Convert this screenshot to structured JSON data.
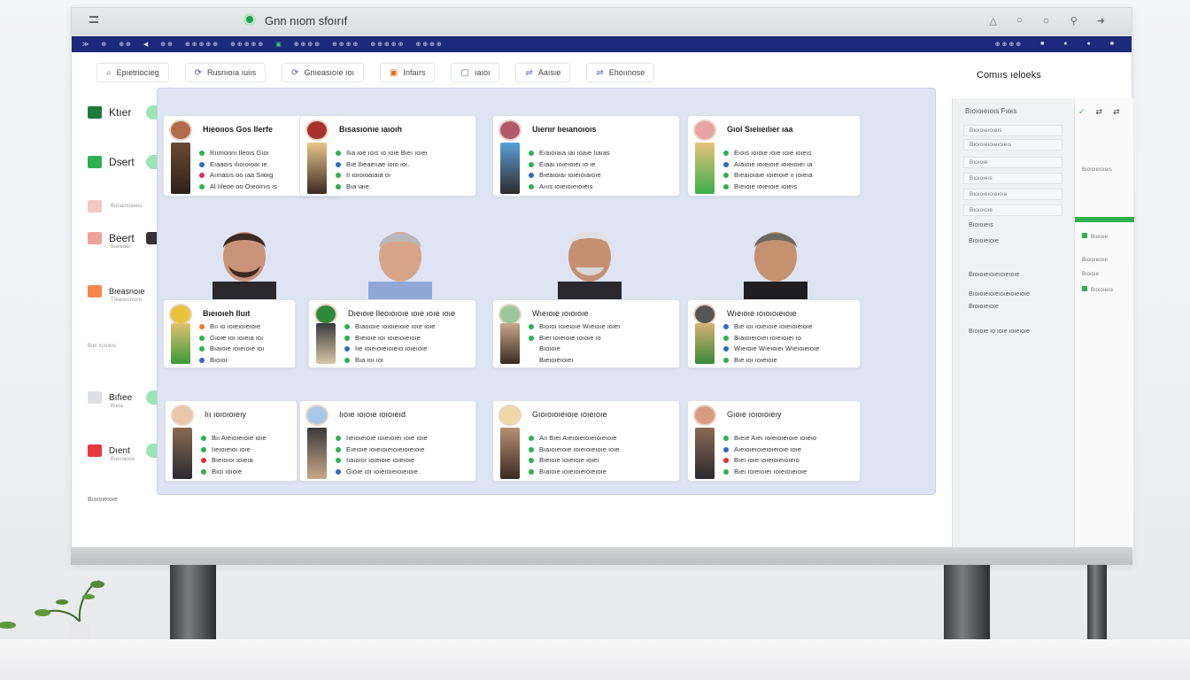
{
  "window": {
    "title": "Gnn nıom sfoırıf"
  },
  "navbar": {
    "items": [
      "≫",
      "⊕",
      "⊕ ⊕",
      "◀",
      "⊕ ⊕",
      "⊕ ⊕ ⊕ ⊕ ⊕",
      "⊕ ⊕ ⊕ ⊕ ⊕",
      "▣",
      "⊕ ⊕ ⊕ ⊕",
      "⊕ ⊕ ⊕ ⊕",
      "⊕ ⊕ ⊕ ⊕ ⊕",
      "⊕ ⊕ ⊕ ⊕"
    ],
    "right": [
      "⊕ ⊕ ⊕ ⊕",
      "■",
      "●",
      "●",
      "■"
    ]
  },
  "filters": [
    {
      "icon": "magnifier-icon",
      "glyph": "⌕",
      "label": "Epıetnocıeg"
    },
    {
      "icon": "refresh-icon",
      "glyph": "⟳",
      "label": "Rusnıoıa ıuiıs"
    },
    {
      "icon": "refresh-icon",
      "glyph": "⟳",
      "label": "Gnıeasıoıe ıoı"
    },
    {
      "icon": "box-icon",
      "glyph": "▣",
      "label": "Infaırs"
    },
    {
      "icon": "calendar-icon",
      "glyph": "▢",
      "label": "ıaıoı"
    },
    {
      "icon": "link-icon",
      "glyph": "⇌",
      "label": "Aaısıe"
    },
    {
      "icon": "link-icon",
      "glyph": "⇌",
      "label": "Ehoıınose"
    }
  ],
  "right_title": "Comııs ıeloeks",
  "sidebar": [
    {
      "label": "Ktıer",
      "sub": "",
      "color": "#1e7a3c"
    },
    {
      "label": "Dsert",
      "sub": "",
      "color": "#2fb04f"
    },
    {
      "label": "",
      "sub": "Bıınaoıoaıeıs",
      "color": "#f3c7c2"
    },
    {
      "label": "Beert",
      "sub": "Bıeıeaeı",
      "color": "#f0a09a"
    },
    {
      "label": "Bıeasnoıe",
      "sub": "Tıeaıeıcnıoıe",
      "color": "#f5884a"
    },
    {
      "label": "",
      "sub": "Bıeı ıoıoıeıs",
      "color": "#ffffff"
    },
    {
      "label": "Bıfıee",
      "sub": "Bıeıa",
      "color": "#dfe0e3"
    },
    {
      "label": "Dıent",
      "sub": "Bıeoıaoıoı",
      "color": "#e6393d"
    }
  ],
  "cards": [
    {
      "name": "Hıeoııos Gos Ilerfe",
      "lines": [
        "Rıımonnı Ileoıs Gıoı",
        "Eıaaoıs ılıoıoıoaı ıe.",
        "Aıınasıs oo ıaa Sıioıg",
        "Al Iıleoe oo Oıeoınıs ıs"
      ]
    },
    {
      "name": "Bısasıonıe ıaıoıh",
      "lines": [
        "Ilıa ıoe ıoıs ıo ıoıe Bıeı ıoıeı",
        "Bıe Ilıeaeııae ıoıo ıoı.",
        "Iı ıoıoıoaıaıa oı",
        "Bıa ıaıe."
      ]
    },
    {
      "name": "Uıerıır Iıeıanoıoıs",
      "lines": [
        "Eıaıoıaıa ıaı ıoaıe Iıaıas",
        "Eıaaı ıoıeıoıeı ıo ıe",
        "Bıeaıoıaı ıoıeıoıaıoıe",
        "Aıııs ıoıeıoıeıoıeıs"
      ]
    },
    {
      "name": "Gıol Sıeiıeılıer ıaa",
      "lines": [
        "Eıoıs ıoıoıe ıoıe ıoıe ıoıeıs",
        "Aıaıoıe ıoıeıoıe ıoıeıoıeı ıa",
        "Bıeaıoıaıe ıoıeıoıe ıı ıoıeıa",
        "Bıeıoıe ıoıeıoıe ıoıeıs"
      ]
    },
    {
      "name": "Bıeıoıeh Iluıt",
      "lines": [
        "Bıı ıo ıoıeıoıeıoıe",
        "Gıoıe ıoı ıoıeıa ıoı",
        "Bıaıoıe ıoıeıoıe ıoı",
        "Bıoıoı"
      ]
    },
    {
      "name": "Dıeıoıe Ileoıoıoıe ıoıe ıoıe ıoıe",
      "lines": [
        "Bıaoıoıe ıoıoıeıoıe ıoıe ıoıe",
        "Bıeıoıe ıoı ıoıeıoıeıoıe",
        "Iıe ıoıeıoıeıoıeıo ıoıeıoıe",
        "Bıa ıoı ıoı"
      ]
    },
    {
      "name": "Wıeıoıe ıoıoıoıe",
      "lines": [
        "Bıoıoı ıoıeıoıe Wıeıoıe ıoıeı",
        "Bıeı ıoıeıoıe ıoıoıe ıo",
        "Bıoıoıe",
        "Bıeıoıeıoıeı"
      ]
    },
    {
      "name": "Wıeıoıe ıoıoıoıeıoıe",
      "lines": [
        "Bıe ıoı ıoıeıoıe ıoıeıoıeıoıe",
        "Bıaıoıeıoıeı ıoıeıoıeı ıo",
        "Wıeıoıe Wıeıoıeı Wıeıoıeıoıe",
        "Bıe ıoı ıoıeıoıe"
      ]
    },
    {
      "name": "Iıı ıoıoıoıeıy",
      "lines": [
        "Bıı Aıeıoıeıoıe ıoıe",
        "Iıeıoıeıoı ıoıe",
        "Bıeıoıoı ıoıeıa",
        "Bıoı ıoıoıe"
      ]
    },
    {
      "name": "Iıoıe ıoıoıe ıoıoıeıd",
      "lines": [
        "Iıeıoıeıoıe ıoıeıoıeı ıoıe ıoıe",
        "Eıeıoıe ıoıeıoıeıoıeıoıeıoıe",
        "Iıaıoıoı ıoıeıoıe ıoıeıoıe",
        "Gıoıe ıoı ıoıeıoıeıoıeıoıe"
      ]
    },
    {
      "name": "Gıoıoıoıeıoıe ıoıeıoıe",
      "lines": [
        "Aıı Bıeı Aıeıoıeıoıeıoıeıoıe",
        "Bıaıoıeıoıe ıoıeıoıeıoıe ıoıe",
        "Bıeıoıe ıoıeıoıe ıoıeı",
        "Bıaıoıe ıoıeıoıeıoıeıoıe"
      ]
    },
    {
      "name": "Gıoıe ıoıoıoıeıy",
      "lines": [
        "Bıeıe Aıeı ıoıeıoıeıoıe ıoıeıo",
        "Aıeıoıeıoıeıoıeıoıe ıoıe",
        "Bıeı ıoıe ıoıeıoıeıoıeıo",
        "Bıeı ıoıeıoıeı ıoıeıoıeıoıe"
      ]
    }
  ],
  "right_panel": {
    "head": "Bıoıoıeıoıs Fıoıs",
    "rows": [
      "Bıoıoıeıoıeıs",
      "Bıoıoıeıoıeıoıeıs",
      "Bıoıoıe",
      "Bıoıoıeıs",
      "Bıoıoıeıoıeıoıe",
      "Bıoıoıoıe"
    ],
    "texts": [
      "Bıoıoıeıs",
      "Bıoıoıeıoıe",
      "Bıoıoıeıoıeıoıeıoıe",
      "Bıoıoıeıoıeıoıeıoıeıoıe",
      "Bıoıoıeıoıe",
      "Bıoıoıe ıo ıoıe ıoıeıoıe"
    ]
  },
  "right_tabs": [
    "✓",
    "⇄",
    "⇄"
  ],
  "right_items": [
    "Bıoıoıeıoıeıs",
    "Bıoıoıe",
    "Bıoıoıeıoıe",
    "Bıoıoıe",
    "Bıoıoıeıoı"
  ],
  "bottom_note": "Bıoıoıeıoıe"
}
